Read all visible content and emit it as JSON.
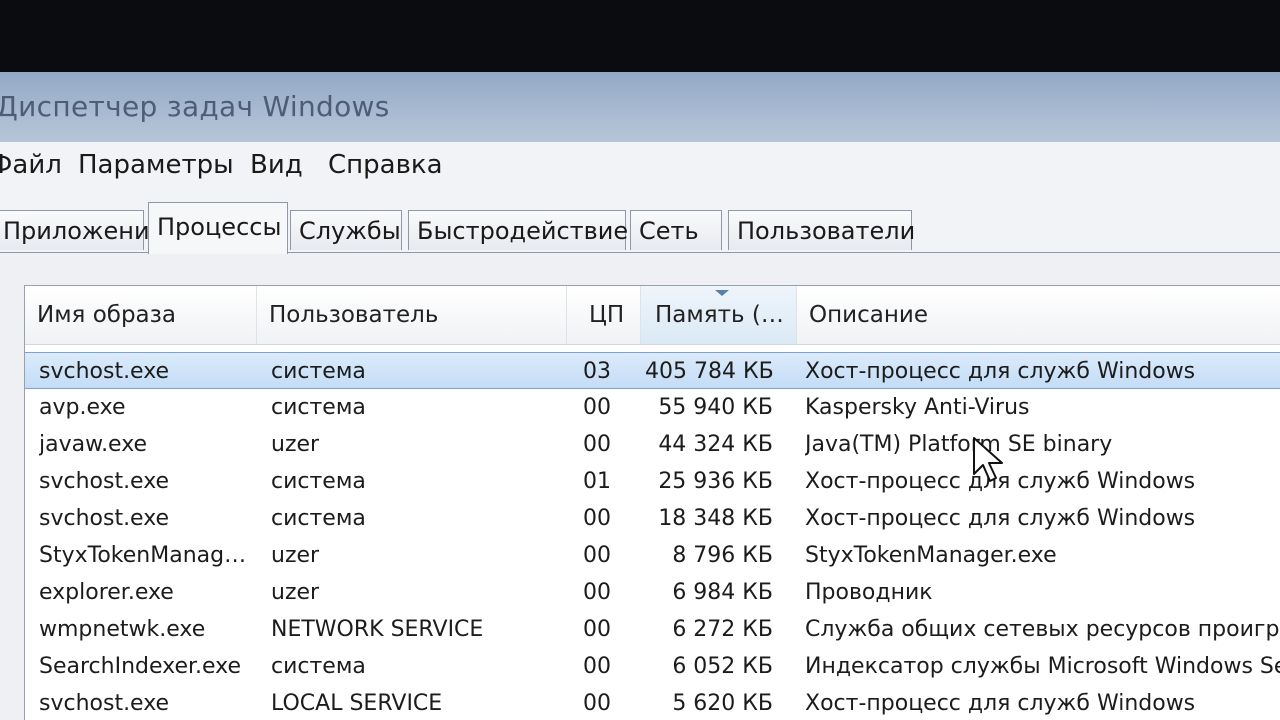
{
  "window": {
    "title": "Диспетчер задач Windows"
  },
  "menu": [
    "Файл",
    "Параметры",
    "Вид",
    "Справка"
  ],
  "tabs": [
    "Приложения",
    "Процессы",
    "Службы",
    "Быстродействие",
    "Сеть",
    "Пользователи"
  ],
  "active_tab": "Процессы",
  "columns": [
    "Имя образа",
    "Пользователь",
    "ЦП",
    "Память (…",
    "Описание"
  ],
  "sorted_column": "Память (…",
  "processes": [
    {
      "name": "svchost.exe",
      "user": "система",
      "cpu": "03",
      "memory": "405 784 КБ",
      "description": "Хост-процесс для служб Windows"
    },
    {
      "name": "avp.exe",
      "user": "система",
      "cpu": "00",
      "memory": "55 940 КБ",
      "description": "Kaspersky Anti-Virus"
    },
    {
      "name": "javaw.exe",
      "user": "uzer",
      "cpu": "00",
      "memory": "44 324 КБ",
      "description": "Java(TM) Platform SE binary"
    },
    {
      "name": "svchost.exe",
      "user": "система",
      "cpu": "01",
      "memory": "25 936 КБ",
      "description": "Хост-процесс для служб Windows"
    },
    {
      "name": "svchost.exe",
      "user": "система",
      "cpu": "00",
      "memory": "18 348 КБ",
      "description": "Хост-процесс для служб Windows"
    },
    {
      "name": "StyxTokenManag…",
      "user": "uzer",
      "cpu": "00",
      "memory": "8 796 КБ",
      "description": "StyxTokenManager.exe"
    },
    {
      "name": "explorer.exe",
      "user": "uzer",
      "cpu": "00",
      "memory": "6 984 КБ",
      "description": "Проводник"
    },
    {
      "name": "wmpnetwk.exe",
      "user": "NETWORK SERVICE",
      "cpu": "00",
      "memory": "6 272 КБ",
      "description": "Служба общих сетевых ресурсов проигрыв"
    },
    {
      "name": "SearchIndexer.exe",
      "user": "система",
      "cpu": "00",
      "memory": "6 052 КБ",
      "description": "Индексатор службы Microsoft Windows Searc"
    },
    {
      "name": "svchost.exe",
      "user": "LOCAL SERVICE",
      "cpu": "00",
      "memory": "5 620 КБ",
      "description": "Хост-процесс для служб Windows"
    }
  ],
  "selected_row": 0,
  "colors": {
    "titlebar": "#a9bbd2",
    "selection": "#c3dcf6",
    "background": "#dfe3ea"
  }
}
